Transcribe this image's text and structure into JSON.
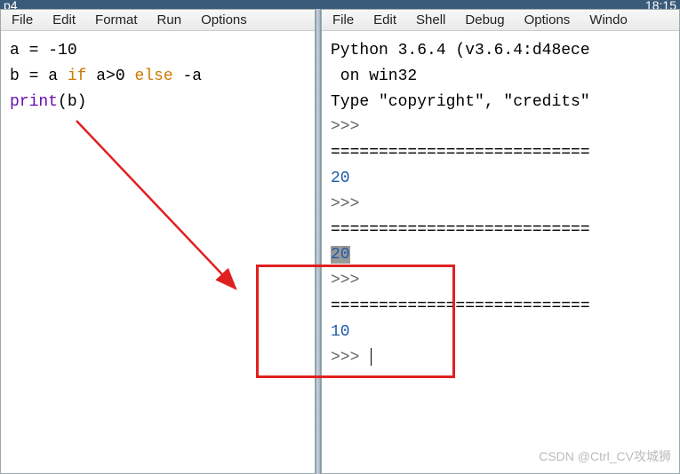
{
  "topbar": {
    "left_label": "p4",
    "right_time": "18:15"
  },
  "editor_menu": [
    "File",
    "Edit",
    "Format",
    "Run",
    "Options"
  ],
  "shell_menu": [
    "File",
    "Edit",
    "Shell",
    "Debug",
    "Options",
    "Windo"
  ],
  "code": {
    "line1_a": "a = ",
    "line1_num": "-10",
    "line2_pre": "b = a ",
    "line2_if": "if",
    "line2_mid": " a>0 ",
    "line2_else": "else",
    "line2_post": " -a",
    "line3_fn": "print",
    "line3_arg": "(b)"
  },
  "shell": {
    "version": "Python 3.6.4 (v3.6.4:d48ece",
    "platform": " on win32",
    "type_line": "Type \"copyright\", \"credits\"",
    "prompt": ">>>",
    "separator": "===========================",
    "out1": "20",
    "out2": "20",
    "out3": "10"
  },
  "watermark": "CSDN @Ctrl_CV攻城狮"
}
